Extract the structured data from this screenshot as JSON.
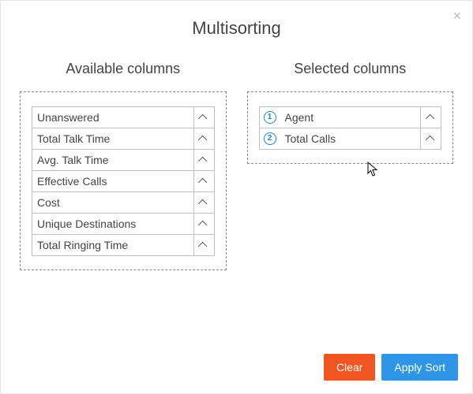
{
  "dialog": {
    "title": "Multisorting",
    "close_label": "×"
  },
  "panels": {
    "available": {
      "title": "Available columns",
      "items": [
        {
          "label": "Unanswered"
        },
        {
          "label": "Total Talk Time"
        },
        {
          "label": "Avg. Talk Time"
        },
        {
          "label": "Effective Calls"
        },
        {
          "label": "Cost"
        },
        {
          "label": "Unique Destinations"
        },
        {
          "label": "Total Ringing Time"
        }
      ]
    },
    "selected": {
      "title": "Selected columns",
      "items": [
        {
          "order": "1",
          "label": "Agent"
        },
        {
          "order": "2",
          "label": "Total Calls"
        }
      ]
    }
  },
  "buttons": {
    "clear": "Clear",
    "apply": "Apply Sort"
  },
  "colors": {
    "accent_orange": "#f05522",
    "accent_blue": "#2f95e6",
    "badge_blue": "#1e86d6"
  }
}
